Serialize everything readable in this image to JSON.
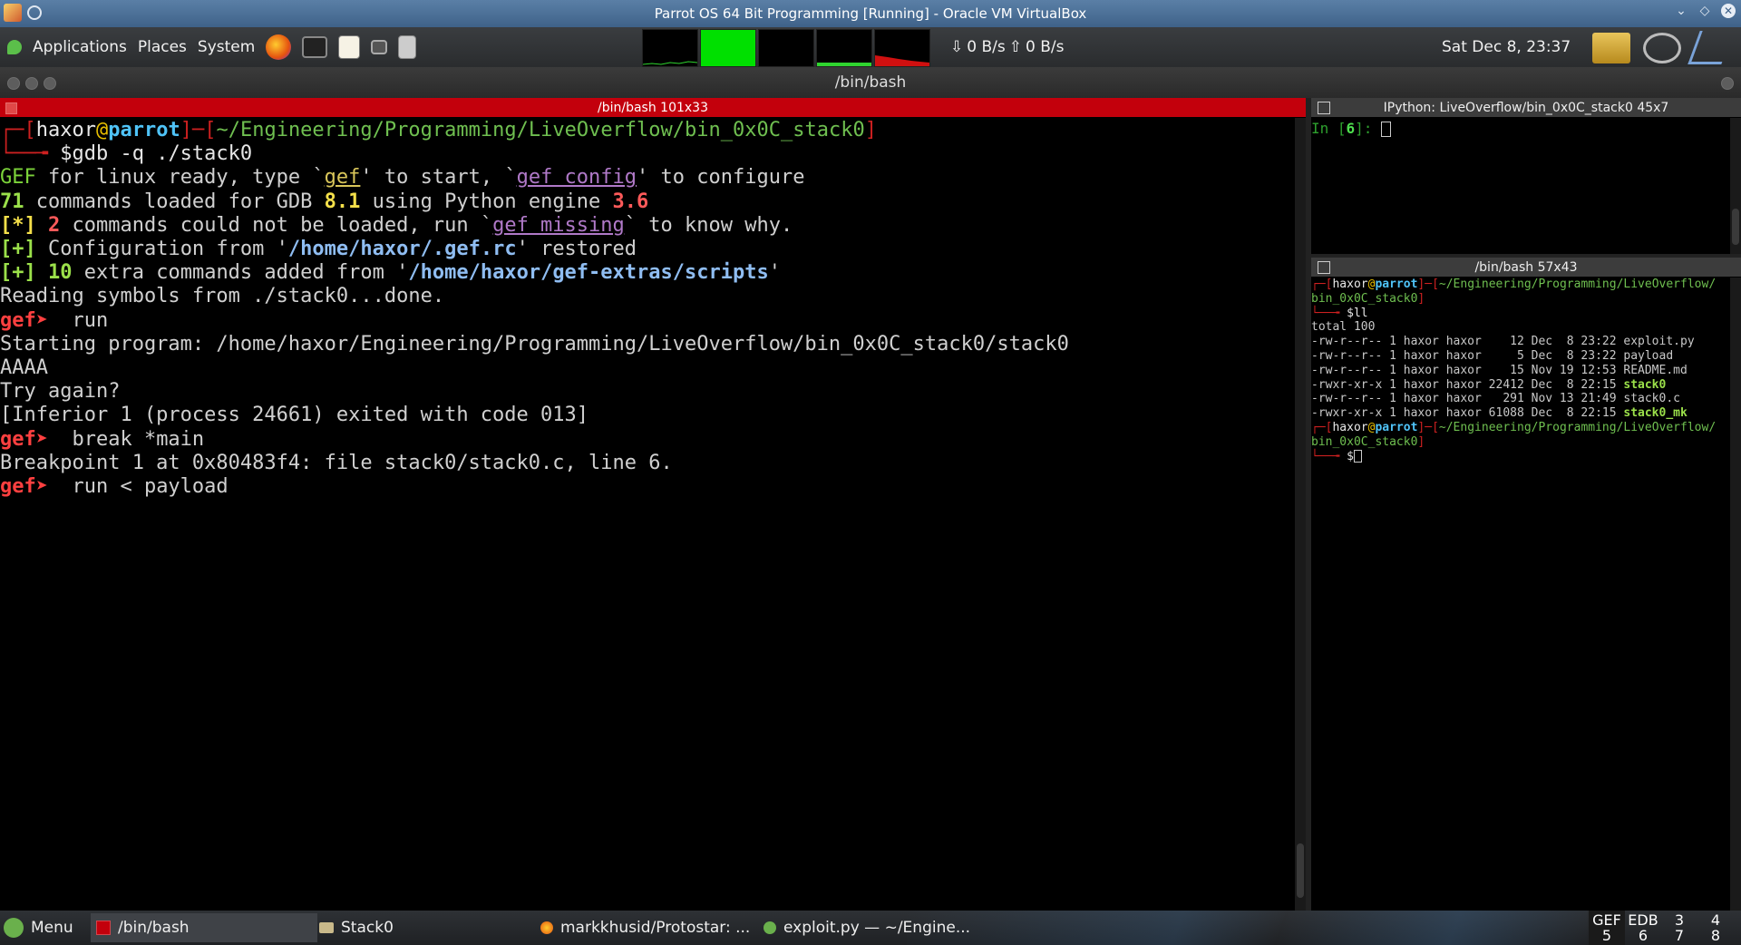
{
  "vbox_window": {
    "title": "Parrot OS 64 Bit Programming [Running] - Oracle VM VirtualBox"
  },
  "top_panel": {
    "menus": [
      "Applications",
      "Places",
      "System"
    ],
    "net_down": "0 B/s",
    "net_up": "0 B/s",
    "clock": "Sat Dec  8, 23:37"
  },
  "terminal_window": {
    "title": "/bin/bash"
  },
  "main_pane": {
    "title": "/bin/bash 101x33"
  },
  "ipython_pane": {
    "title": "IPython: LiveOverflow/bin_0x0C_stack0 45x7",
    "prompt_in": "In [",
    "prompt_num": "6",
    "prompt_end": "]: "
  },
  "bash2_pane": {
    "title": "/bin/bash 57x43",
    "prompt_user": "haxor",
    "prompt_host": "parrot",
    "prompt_path_1": "~/Engineering/Programming/LiveOverflow/",
    "prompt_path_2": "bin_0x0C_stack0",
    "cmd": "$ll",
    "total": "total 100",
    "files": [
      {
        "perm": "-rw-r--r--",
        "links": "1",
        "user": "haxor",
        "group": "haxor",
        "size": "12",
        "date": "Dec  8 23:22",
        "name": "exploit.py",
        "exec": false
      },
      {
        "perm": "-rw-r--r--",
        "links": "1",
        "user": "haxor",
        "group": "haxor",
        "size": "5",
        "date": "Dec  8 23:22",
        "name": "payload",
        "exec": false
      },
      {
        "perm": "-rw-r--r--",
        "links": "1",
        "user": "haxor",
        "group": "haxor",
        "size": "15",
        "date": "Nov 19 12:53",
        "name": "README.md",
        "exec": false
      },
      {
        "perm": "-rwxr-xr-x",
        "links": "1",
        "user": "haxor",
        "group": "haxor",
        "size": "22412",
        "date": "Dec  8 22:15",
        "name": "stack0",
        "exec": true
      },
      {
        "perm": "-rw-r--r--",
        "links": "1",
        "user": "haxor",
        "group": "haxor",
        "size": "291",
        "date": "Nov 13 21:49",
        "name": "stack0.c",
        "exec": false
      },
      {
        "perm": "-rwxr-xr-x",
        "links": "1",
        "user": "haxor",
        "group": "haxor",
        "size": "61088",
        "date": "Dec  8 22:15",
        "name": "stack0_mk",
        "exec": true
      }
    ],
    "prompt2_dollar": "$"
  },
  "main_terminal": {
    "prompt_user": "haxor",
    "prompt_at": "@",
    "prompt_host": "parrot",
    "prompt_path": "~/Engineering/Programming/LiveOverflow/bin_0x0C_stack0",
    "cmd1": "$gdb -q ./stack0",
    "gef_line": {
      "a": "GEF",
      "b": " for linux ready, type `",
      "c": "gef",
      "d": "' to start, `",
      "e": "gef config",
      "f": "' to configure"
    },
    "loaded_line": {
      "n": "71",
      "a": " commands loaded for GDB ",
      "gdb": "8.1",
      "b": " using Python engine ",
      "py": "3.6"
    },
    "missing_line": {
      "tag": "[*]",
      "n": "2",
      "a": " commands could not be loaded, run `",
      "cmd": "gef missing",
      "b": "` to know why."
    },
    "config_line": {
      "tag": "[+]",
      "a": " Configuration from '",
      "path": "/home/haxor/.gef.rc",
      "b": "' restored"
    },
    "extra_line": {
      "tag": "[+]",
      "n": "10",
      "a": " extra commands added from '",
      "path": "/home/haxor/gef-extras/scripts",
      "b": "'"
    },
    "reading": "Reading symbols from ./stack0...done.",
    "gef_prompt": "gef➤",
    "cmd_run": "  run",
    "starting": "Starting program: /home/haxor/Engineering/Programming/LiveOverflow/bin_0x0C_stack0/stack0",
    "input": "AAAA",
    "try_again": "Try again?",
    "inferior": "[Inferior 1 (process 24661) exited with code 013]",
    "cmd_break": "  break *main",
    "breakpoint": "Breakpoint 1 at 0x80483f4: file stack0/stack0.c, line 6.",
    "cmd_run2": "  run < payload"
  },
  "bottom_panel": {
    "menu_label": "Menu",
    "tasks": [
      {
        "label": "/bin/bash",
        "icon": "terminal-icon",
        "active": true
      },
      {
        "label": "Stack0",
        "icon": "folder-icon",
        "active": false
      },
      {
        "label": "markkhusid/Protostar: ...",
        "icon": "firefox-icon",
        "active": false
      },
      {
        "label": "exploit.py — ~/Engine...",
        "icon": "gedit-icon",
        "active": false
      }
    ],
    "workspaces": [
      {
        "top": "GEF",
        "bottom": "5"
      },
      {
        "top": "EDB",
        "bottom": "6"
      },
      {
        "top": "3",
        "bottom": "7"
      },
      {
        "top": "4",
        "bottom": "8"
      }
    ]
  }
}
